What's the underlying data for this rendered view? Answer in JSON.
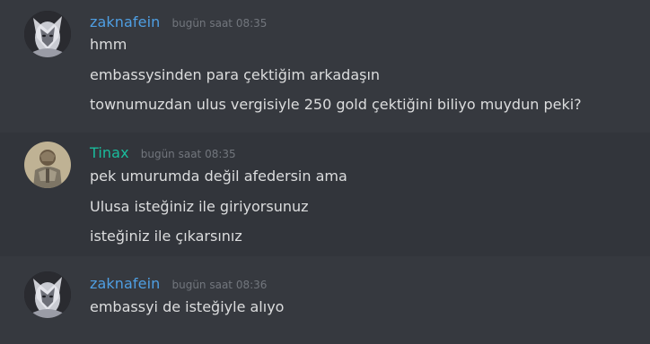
{
  "colors": {
    "background": "#36393f",
    "highlight_background": "#32353b",
    "user_zaknafein": "#4f9fe3",
    "user_tinax": "#1abc9c",
    "message_text": "#dcddde",
    "timestamp": "#72767d"
  },
  "messages": [
    {
      "username": "zaknafein",
      "timestamp": "bugün saat 08:35",
      "avatar_icon": "dark-elf-avatar",
      "lines": [
        "hmm",
        "embassysinden para çektiğim arkadaşın",
        "townumuzdan ulus vergisiyle 250 gold çektiğini biliyo muydun peki?"
      ]
    },
    {
      "username": "Tinax",
      "timestamp": "bugün saat 08:35",
      "avatar_icon": "armored-knight-avatar",
      "lines": [
        "pek umurumda değil afedersin ama",
        "Ulusa isteğiniz ile giriyorsunuz",
        "isteğiniz ile çıkarsınız"
      ]
    },
    {
      "username": "zaknafein",
      "timestamp": "bugün saat 08:36",
      "avatar_icon": "dark-elf-avatar",
      "lines": [
        "embassyi de isteğiyle alıyo"
      ]
    }
  ]
}
